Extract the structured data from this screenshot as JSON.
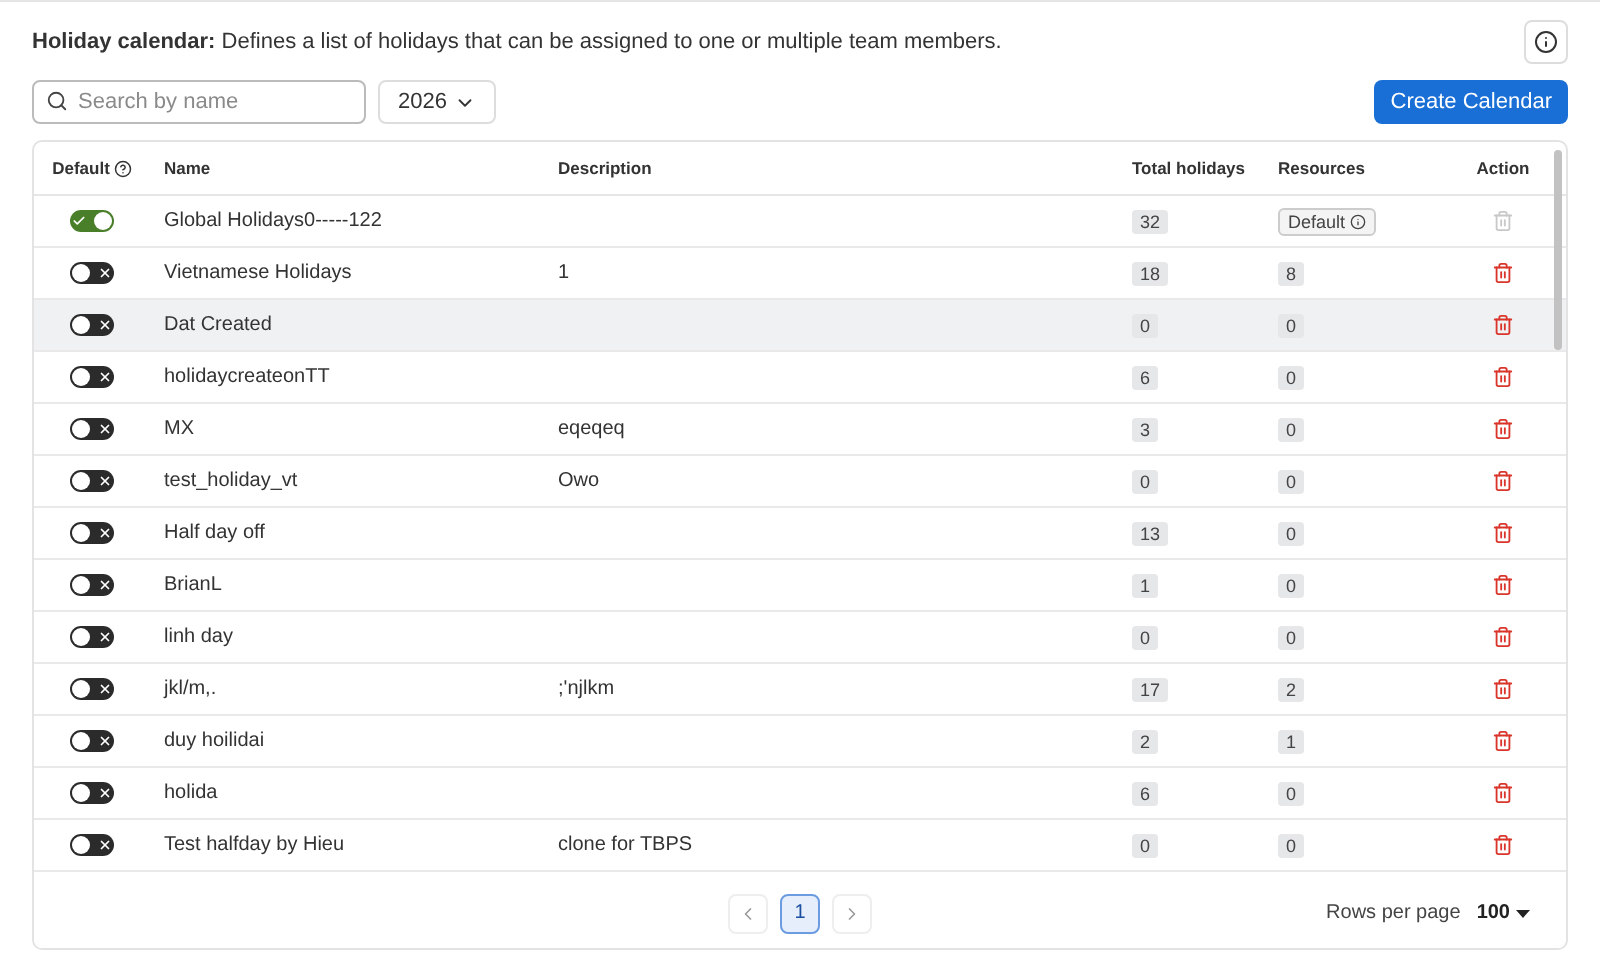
{
  "intro": {
    "title": "Holiday calendar:",
    "text": "Defines a list of holidays that can be assigned to one or multiple team members."
  },
  "search": {
    "placeholder": "Search by name"
  },
  "year_select": {
    "value": "2026"
  },
  "create_button": "Create Calendar",
  "table": {
    "columns": [
      "Default",
      "Name",
      "Description",
      "Total holidays",
      "Resources",
      "Action"
    ],
    "rows": [
      {
        "default_on": true,
        "name": "Global Holidays0-----122",
        "description": "",
        "total": "32",
        "resources": "Default",
        "resources_default_tag": true,
        "delete_disabled": true,
        "highlighted": false
      },
      {
        "default_on": false,
        "name": "Vietnamese Holidays",
        "description": "1",
        "total": "18",
        "resources": "8",
        "resources_default_tag": false,
        "delete_disabled": false,
        "highlighted": false
      },
      {
        "default_on": false,
        "name": "Dat Created",
        "description": "",
        "total": "0",
        "resources": "0",
        "resources_default_tag": false,
        "delete_disabled": false,
        "highlighted": true
      },
      {
        "default_on": false,
        "name": "holidaycreateonTT",
        "description": "",
        "total": "6",
        "resources": "0",
        "resources_default_tag": false,
        "delete_disabled": false,
        "highlighted": false
      },
      {
        "default_on": false,
        "name": "MX",
        "description": "eqeqeq",
        "total": "3",
        "resources": "0",
        "resources_default_tag": false,
        "delete_disabled": false,
        "highlighted": false
      },
      {
        "default_on": false,
        "name": "test_holiday_vt",
        "description": "Owo",
        "total": "0",
        "resources": "0",
        "resources_default_tag": false,
        "delete_disabled": false,
        "highlighted": false
      },
      {
        "default_on": false,
        "name": "Half day off",
        "description": "",
        "total": "13",
        "resources": "0",
        "resources_default_tag": false,
        "delete_disabled": false,
        "highlighted": false
      },
      {
        "default_on": false,
        "name": "BrianL",
        "description": "",
        "total": "1",
        "resources": "0",
        "resources_default_tag": false,
        "delete_disabled": false,
        "highlighted": false
      },
      {
        "default_on": false,
        "name": "linh day",
        "description": "",
        "total": "0",
        "resources": "0",
        "resources_default_tag": false,
        "delete_disabled": false,
        "highlighted": false
      },
      {
        "default_on": false,
        "name": "jkl/m,.",
        "description": ";'njlkm",
        "total": "17",
        "resources": "2",
        "resources_default_tag": false,
        "delete_disabled": false,
        "highlighted": false
      },
      {
        "default_on": false,
        "name": "duy hoilidai",
        "description": "",
        "total": "2",
        "resources": "1",
        "resources_default_tag": false,
        "delete_disabled": false,
        "highlighted": false
      },
      {
        "default_on": false,
        "name": "holida",
        "description": "",
        "total": "6",
        "resources": "0",
        "resources_default_tag": false,
        "delete_disabled": false,
        "highlighted": false
      },
      {
        "default_on": false,
        "name": "Test halfday by Hieu",
        "description": "clone for TBPS",
        "total": "0",
        "resources": "0",
        "resources_default_tag": false,
        "delete_disabled": false,
        "highlighted": false
      }
    ]
  },
  "pagination": {
    "pages": [
      {
        "label": "1",
        "selected": true
      }
    ],
    "rows_per_page_label": "Rows per page",
    "rows_per_page": "100"
  }
}
